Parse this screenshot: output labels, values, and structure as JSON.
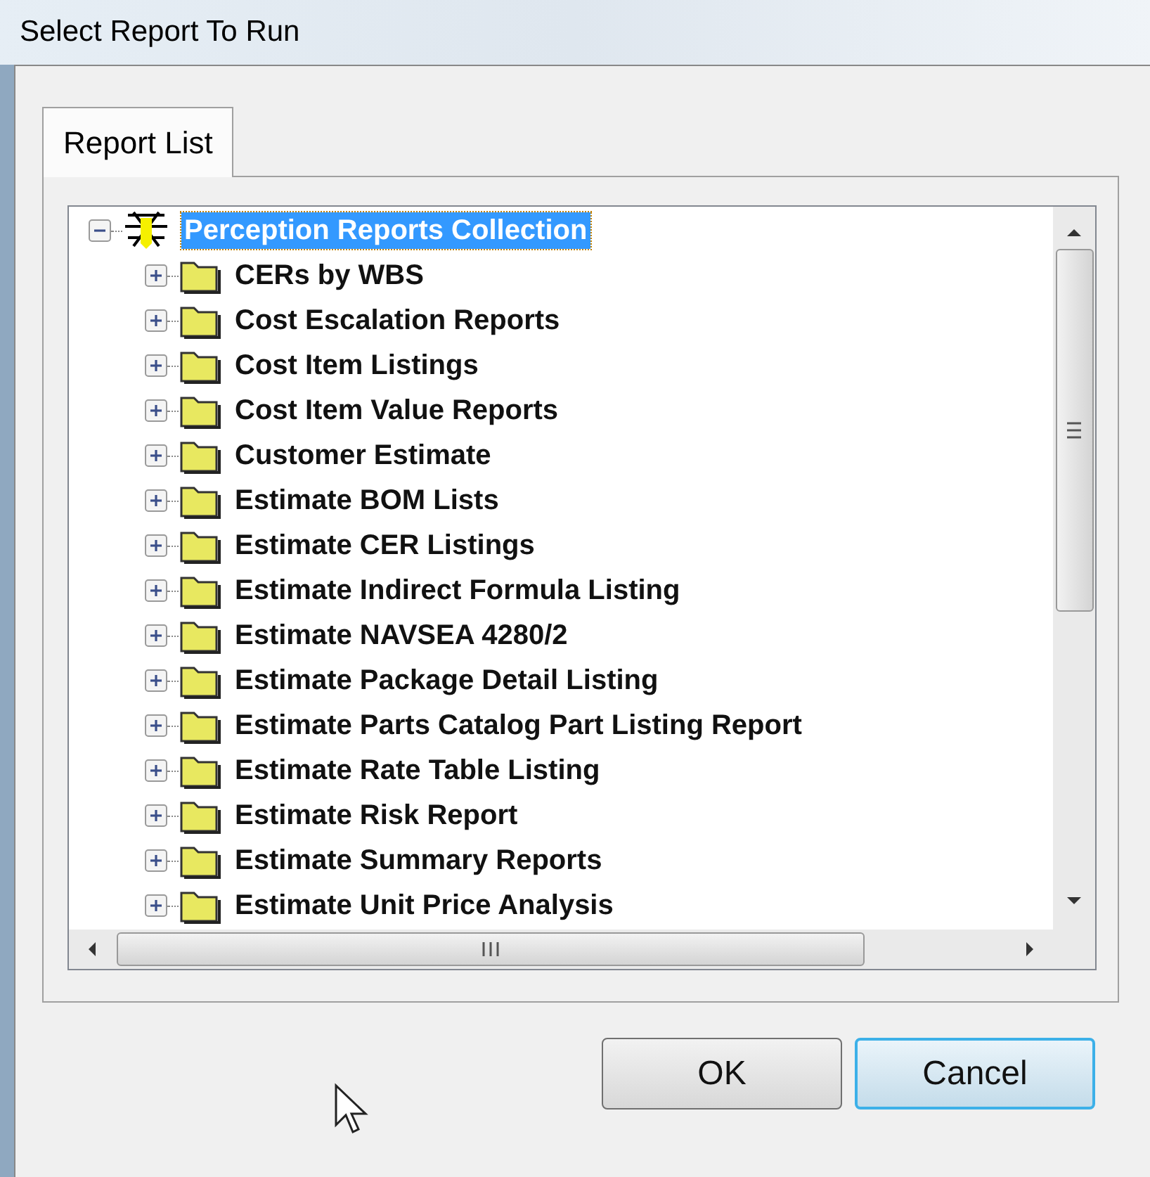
{
  "window": {
    "title": "Select Report To Run"
  },
  "tabs": [
    {
      "label": "Report List",
      "selected": true
    }
  ],
  "tree": {
    "label": "Perception Reports Collection",
    "selected": true,
    "expanded": true,
    "children": [
      {
        "label": "CERs by WBS",
        "selected": false,
        "expanded": false
      },
      {
        "label": "Cost Escalation Reports",
        "selected": false,
        "expanded": false
      },
      {
        "label": "Cost Item Listings",
        "selected": false,
        "expanded": false
      },
      {
        "label": "Cost Item Value Reports",
        "selected": false,
        "expanded": false
      },
      {
        "label": "Customer Estimate",
        "selected": false,
        "expanded": false
      },
      {
        "label": "Estimate BOM Lists",
        "selected": false,
        "expanded": false
      },
      {
        "label": "Estimate CER Listings",
        "selected": false,
        "expanded": false
      },
      {
        "label": "Estimate Indirect Formula Listing",
        "selected": false,
        "expanded": false
      },
      {
        "label": "Estimate NAVSEA 4280/2",
        "selected": false,
        "expanded": false
      },
      {
        "label": "Estimate Package Detail Listing",
        "selected": false,
        "expanded": false
      },
      {
        "label": "Estimate Parts Catalog Part Listing Report",
        "selected": false,
        "expanded": false
      },
      {
        "label": "Estimate Rate Table Listing",
        "selected": false,
        "expanded": false
      },
      {
        "label": "Estimate Risk Report",
        "selected": false,
        "expanded": false
      },
      {
        "label": "Estimate Summary Reports",
        "selected": false,
        "expanded": false
      },
      {
        "label": "Estimate Unit Price Analysis",
        "selected": false,
        "expanded": false
      }
    ]
  },
  "buttons": [
    {
      "label": "OK",
      "focused": false
    },
    {
      "label": "Cancel",
      "focused": true
    }
  ]
}
